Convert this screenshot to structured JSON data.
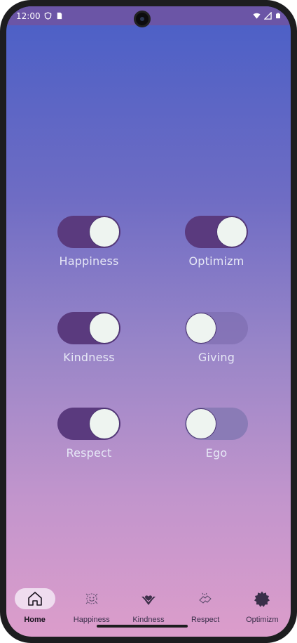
{
  "status_bar": {
    "time": "12:00",
    "left_icons": [
      "shield-icon",
      "sim-card-icon"
    ],
    "right_icons": [
      "wifi-icon",
      "signal-icon",
      "battery-icon"
    ]
  },
  "toggles": [
    {
      "label": "Happiness",
      "on": true
    },
    {
      "label": "Optimizm",
      "on": true
    },
    {
      "label": "Kindness",
      "on": true
    },
    {
      "label": "Giving",
      "on": false
    },
    {
      "label": "Respect",
      "on": true
    },
    {
      "label": "Ego",
      "on": false
    }
  ],
  "bottom_nav": {
    "items": [
      {
        "label": "Home",
        "icon": "home-icon",
        "active": true
      },
      {
        "label": "Happiness",
        "icon": "happiness-icon",
        "active": false
      },
      {
        "label": "Kindness",
        "icon": "kindness-icon",
        "active": false
      },
      {
        "label": "Respect",
        "icon": "respect-icon",
        "active": false
      },
      {
        "label": "Optimizm",
        "icon": "optimizm-icon",
        "active": false
      }
    ]
  },
  "colors": {
    "switch_on": "#5a3a7e",
    "knob": "#eef4f0",
    "status_bar": "#6b55a6",
    "nav_active_pill": "#efdcef"
  }
}
